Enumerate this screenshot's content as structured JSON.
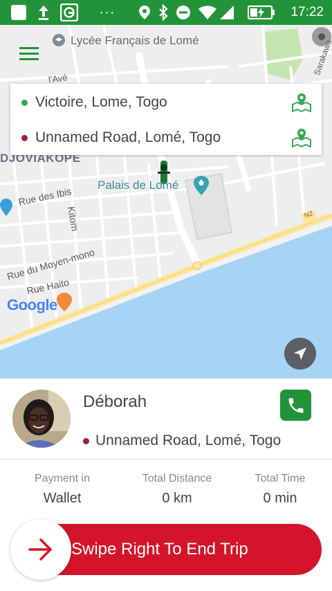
{
  "status_bar": {
    "time": "17:22",
    "icons": [
      "notification-square-icon",
      "download-arrow-icon",
      "app-logo-icon",
      "more-dots-icon",
      "location-icon",
      "bluetooth-icon",
      "do-not-disturb-icon",
      "wifi-icon",
      "signal-icon",
      "battery-charging-icon"
    ]
  },
  "map": {
    "labels": {
      "lycee": "Lycée Français de Lomé",
      "avenue": "l'Avé",
      "sarakawa": "Sarakawa",
      "district": "DJOVIAKOPE",
      "palais": "Palais de Lomé",
      "rue_ibis": "Rue des Ibis",
      "kitom": "Kitom",
      "rue_moyen_mono": "Rue du Moyen-mono",
      "rue_haito": "Rue Haito",
      "n2": "N2"
    },
    "google_logo": "Google",
    "colors": {
      "water": "#a7d3f4",
      "park": "#c5e5b3",
      "main_road": "#fce69a"
    }
  },
  "route_card": {
    "pickup": {
      "text": "Victoire, Lome, Togo",
      "dot_color": "#3aa552"
    },
    "dropoff": {
      "text": "Unnamed Road, Lomé, Togo",
      "dot_color": "#9b2335"
    }
  },
  "driver": {
    "name": "Déborah",
    "destination": "Unnamed Road, Lomé, Togo"
  },
  "stats": [
    {
      "label": "Payment in",
      "value": "Wallet"
    },
    {
      "label": "Total Distance",
      "value": "0 km"
    },
    {
      "label": "Total Time",
      "value": "0 min"
    }
  ],
  "swipe": {
    "label": "Swipe Right To End Trip",
    "color": "#d4142a"
  },
  "colors": {
    "brand_green": "#23933a",
    "accent_red": "#d4142a"
  }
}
